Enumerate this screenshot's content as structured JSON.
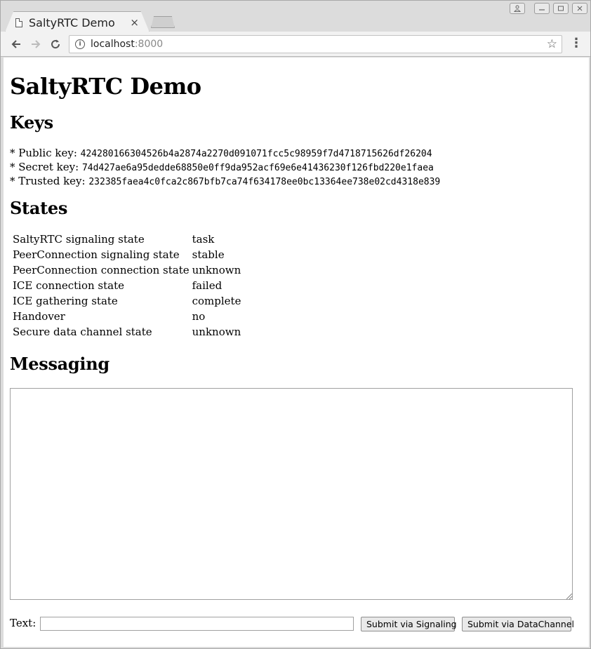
{
  "browser": {
    "tab_title": "SaltyRTC Demo",
    "tab_close": "×",
    "url_host": "localhost",
    "url_port": ":8000",
    "icons": {
      "back": "arrow-left-icon",
      "forward": "arrow-right-icon",
      "reload": "reload-icon",
      "info": "info-icon",
      "bookmark": "star-icon",
      "menu": "kebab-menu-icon",
      "page": "page-icon"
    }
  },
  "page": {
    "title": "SaltyRTC Demo",
    "keys_heading": "Keys",
    "keys": [
      {
        "label": "* Public key: ",
        "value": "424280166304526b4a2874a2270d091071fcc5c98959f7d4718715626df26204"
      },
      {
        "label": "* Secret key: ",
        "value": "74d427ae6a95dedde68850e0ff9da952acf69e6e41436230f126fbd220e1faea"
      },
      {
        "label": "* Trusted key: ",
        "value": "232385faea4c0fca2c867bfb7ca74f634178ee0bc13364ee738e02cd4318e839"
      }
    ],
    "states_heading": "States",
    "states": [
      {
        "label": "SaltyRTC signaling state",
        "value": "task"
      },
      {
        "label": "PeerConnection signaling state",
        "value": "stable"
      },
      {
        "label": "PeerConnection connection state",
        "value": "unknown"
      },
      {
        "label": "ICE connection state",
        "value": "failed"
      },
      {
        "label": "ICE gathering state",
        "value": "complete"
      },
      {
        "label": "Handover",
        "value": "no"
      },
      {
        "label": "Secure data channel state",
        "value": "unknown"
      }
    ],
    "messaging_heading": "Messaging",
    "messages_value": "",
    "text_label": "Text:",
    "text_value": "",
    "submit_signaling": "Submit via Signaling",
    "submit_datachannel": "Submit via DataChannel"
  }
}
